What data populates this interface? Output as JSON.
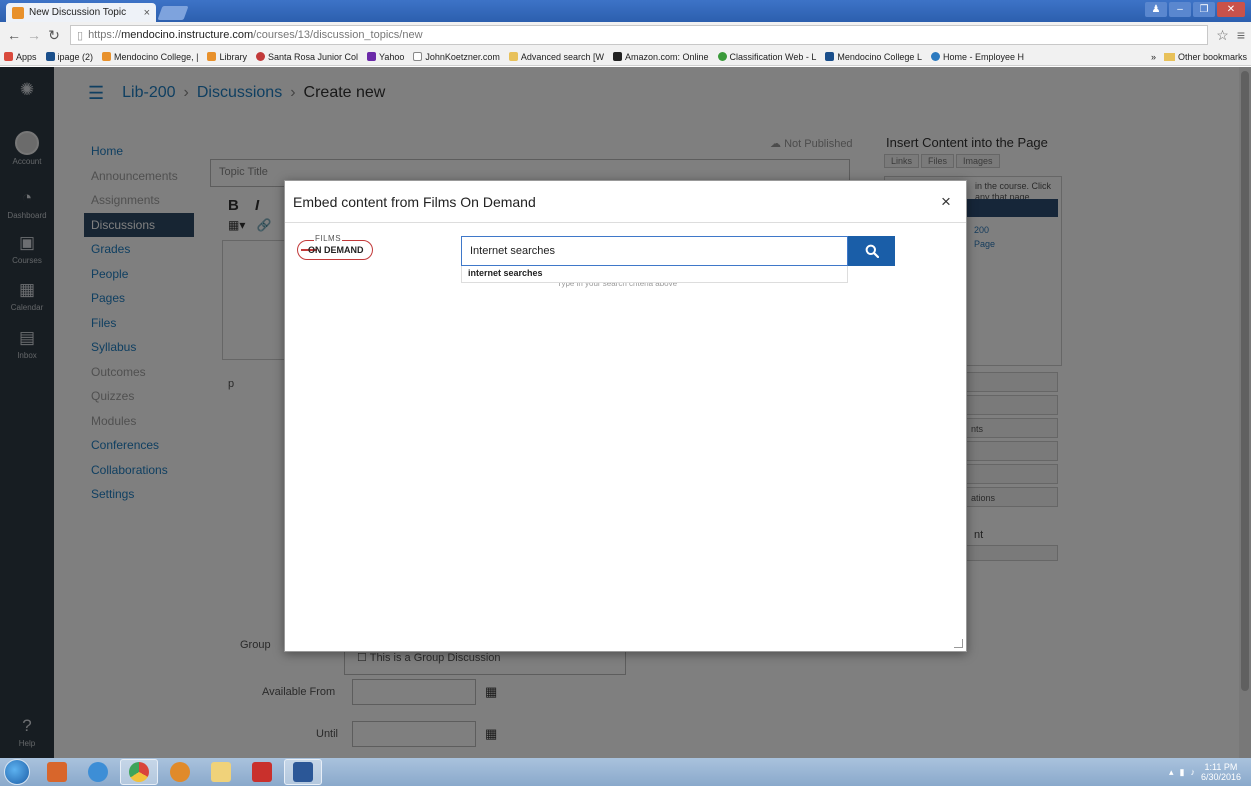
{
  "browser": {
    "tab_title": "New Discussion Topic",
    "url_prefix": "https://",
    "url_host": "mendocino.instructure.com",
    "url_path": "/courses/13/discussion_topics/new",
    "bookmarks": [
      "Apps",
      "ipage (2)",
      "Mendocino College, |",
      "Library",
      "Santa Rosa Junior Col",
      "Yahoo",
      "JohnKoetzner.com",
      "Advanced search [W",
      "Amazon.com: Online",
      "Classification Web - L",
      "Mendocino College L",
      "Home - Employee H"
    ],
    "bookmark_more": "»",
    "other_bookmarks": "Other bookmarks"
  },
  "global_nav": {
    "items": [
      {
        "label": "Account",
        "icon": "account-avatar"
      },
      {
        "label": "Dashboard",
        "icon": "dashboard-icon"
      },
      {
        "label": "Courses",
        "icon": "courses-icon"
      },
      {
        "label": "Calendar",
        "icon": "calendar-icon"
      },
      {
        "label": "Inbox",
        "icon": "inbox-icon"
      },
      {
        "label": "Help",
        "icon": "help-icon"
      }
    ]
  },
  "breadcrumb": [
    "Lib-200",
    "Discussions",
    "Create new"
  ],
  "course_nav": [
    {
      "label": "Home",
      "state": "link"
    },
    {
      "label": "Announcements",
      "state": "muted"
    },
    {
      "label": "Assignments",
      "state": "muted"
    },
    {
      "label": "Discussions",
      "state": "active"
    },
    {
      "label": "Grades",
      "state": "link"
    },
    {
      "label": "People",
      "state": "link"
    },
    {
      "label": "Pages",
      "state": "link"
    },
    {
      "label": "Files",
      "state": "link"
    },
    {
      "label": "Syllabus",
      "state": "link"
    },
    {
      "label": "Outcomes",
      "state": "muted"
    },
    {
      "label": "Quizzes",
      "state": "muted"
    },
    {
      "label": "Modules",
      "state": "muted"
    },
    {
      "label": "Conferences",
      "state": "link"
    },
    {
      "label": "Collaborations",
      "state": "link"
    },
    {
      "label": "Settings",
      "state": "link"
    }
  ],
  "editor": {
    "title_placeholder": "Topic Title",
    "toolbar_bold": "B",
    "toolbar_italic": "I",
    "paragraph_label": "p"
  },
  "publish_status": "Not Published",
  "side_panel": {
    "title": "Insert Content into the Page",
    "tabs": [
      "Links",
      "Files",
      "Images"
    ],
    "description": "in the course. Click any that page",
    "link_200": "200",
    "link_page": "Page",
    "row_text_1": "nts",
    "row_text_2": "ations",
    "heading": "nt"
  },
  "options": {
    "group_label": "Group",
    "group_checkbox_text": "This is a Group Discussion",
    "available_from_label": "Available From",
    "until_label": "Until"
  },
  "modal": {
    "title": "Embed content from Films On Demand",
    "close_symbol": "×",
    "logo_top": "FILMS",
    "logo_bottom": "ON DEMAND",
    "search_value": "Internet searches",
    "suggestion": "internet searches",
    "hint": "Type in your search criteria above"
  },
  "taskbar": {
    "time": "1:11 PM",
    "date": "6/30/2016"
  },
  "colors": {
    "canvas_blue": "#1f7ec2",
    "nav_dark": "#2f3a44",
    "search_button": "#1a5ea8",
    "fod_red": "#c23a3a"
  }
}
